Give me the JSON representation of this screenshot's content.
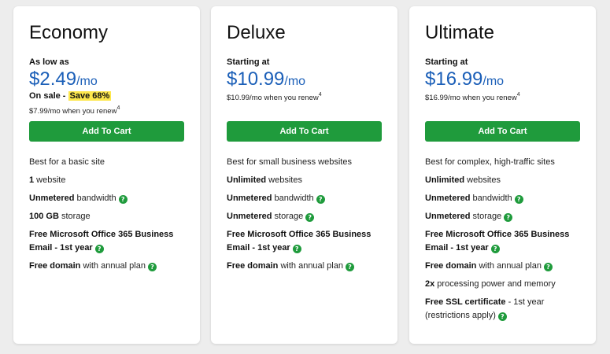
{
  "plans": [
    {
      "name": "Economy",
      "price_label": "As low as",
      "price": "$2.49",
      "per": "/mo",
      "sale_prefix": "On sale - ",
      "sale_badge": "Save 68%",
      "renew": "$7.99/mo when you renew",
      "renew_sup": "4",
      "button": "Add To Cart",
      "features": [
        {
          "bold": "",
          "text": "Best for a basic site"
        },
        {
          "bold": "1",
          "text": " website"
        },
        {
          "bold": "Unmetered",
          "text": " bandwidth"
        },
        {
          "bold": "100 GB",
          "text": " storage"
        },
        {
          "bold": "Free Microsoft Office 365 Business Email - 1st year",
          "text": ""
        },
        {
          "bold": "Free domain",
          "text": " with annual plan"
        }
      ]
    },
    {
      "name": "Deluxe",
      "price_label": "Starting at",
      "price": "$10.99",
      "per": "/mo",
      "renew": "$10.99/mo when you renew",
      "renew_sup": "4",
      "button": "Add To Cart",
      "features": [
        {
          "bold": "",
          "text": "Best for small business websites"
        },
        {
          "bold": "Unlimited",
          "text": " websites"
        },
        {
          "bold": "Unmetered",
          "text": " bandwidth"
        },
        {
          "bold": "Unmetered",
          "text": " storage"
        },
        {
          "bold": "Free Microsoft Office 365 Business Email - 1st year",
          "text": ""
        },
        {
          "bold": "Free domain",
          "text": " with annual plan"
        }
      ]
    },
    {
      "name": "Ultimate",
      "price_label": "Starting at",
      "price": "$16.99",
      "per": "/mo",
      "renew": "$16.99/mo when you renew",
      "renew_sup": "4",
      "button": "Add To Cart",
      "features": [
        {
          "bold": "",
          "text": "Best for complex, high-traffic sites"
        },
        {
          "bold": "Unlimited",
          "text": " websites"
        },
        {
          "bold": "Unmetered",
          "text": " bandwidth"
        },
        {
          "bold": "Unmetered",
          "text": " storage"
        },
        {
          "bold": "Free Microsoft Office 365 Business Email - 1st year",
          "text": ""
        },
        {
          "bold": "Free domain",
          "text": " with annual plan"
        },
        {
          "bold": "2x",
          "text": " processing power and memory"
        },
        {
          "bold": "Free SSL certificate",
          "text": " - 1st year (restrictions apply)"
        }
      ]
    }
  ],
  "help_icon_glyph": "?",
  "colors": {
    "price_blue": "#1b5fb8",
    "button_green": "#1f9b3c",
    "sale_highlight": "#fde74c"
  }
}
